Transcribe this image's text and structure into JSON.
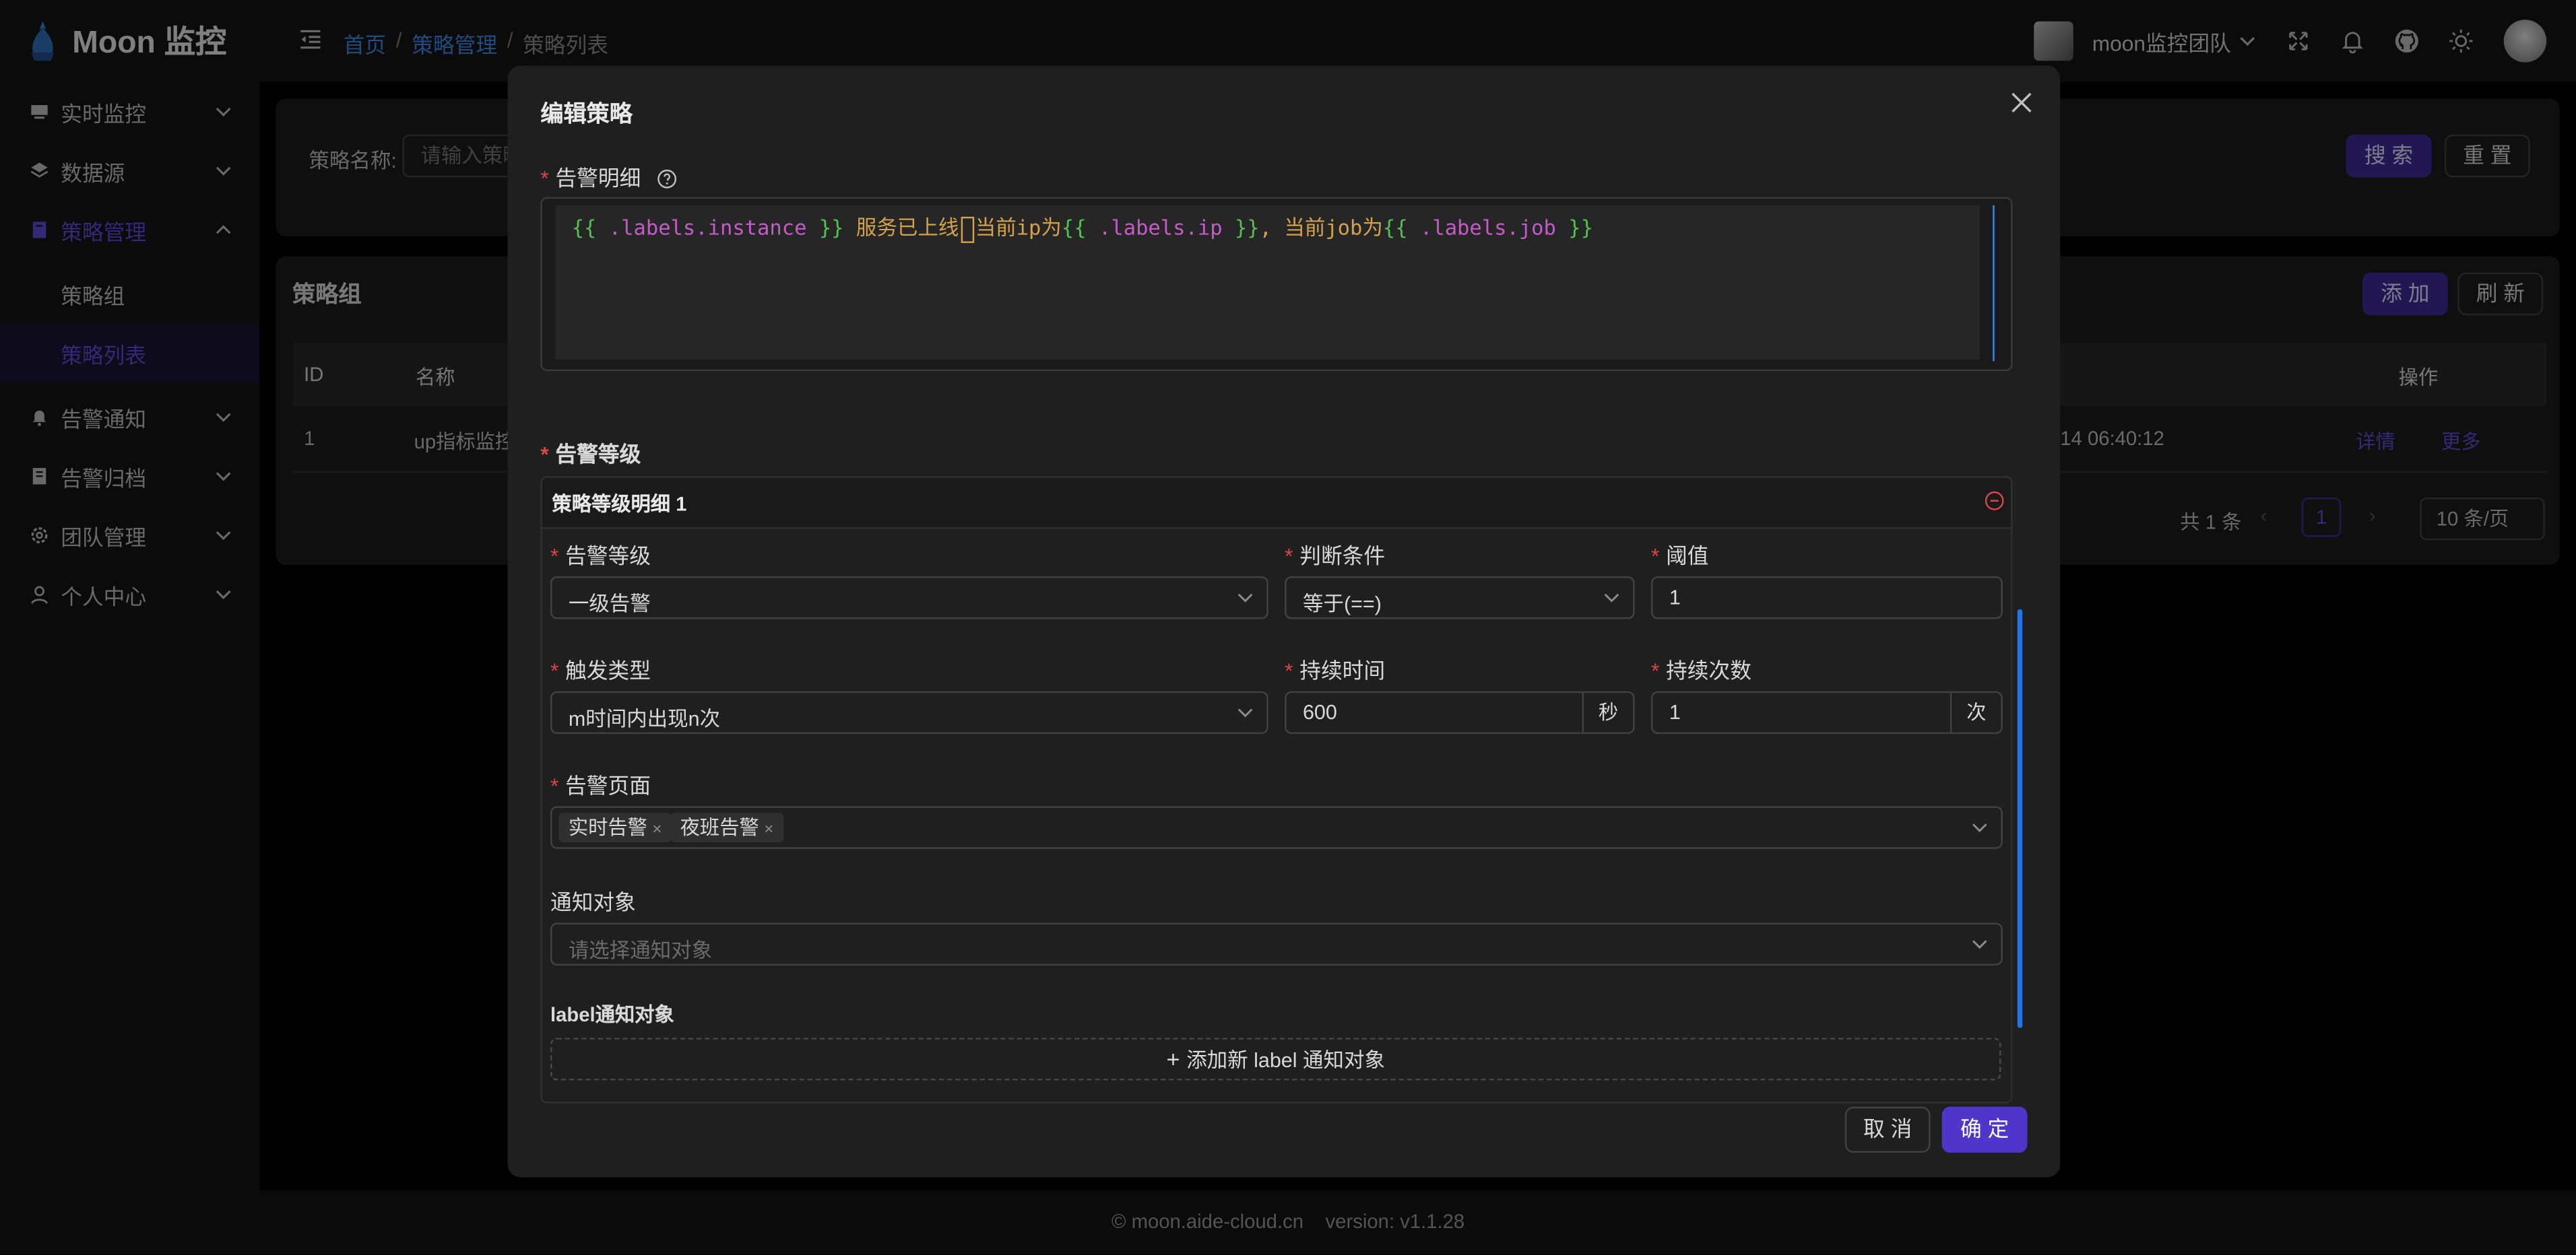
{
  "app": {
    "title": "Moon 监控"
  },
  "breadcrumb": [
    "首页",
    "策略管理",
    "策略列表"
  ],
  "header": {
    "team": "moon监控团队"
  },
  "sidebar": {
    "items": [
      {
        "label": "实时监控"
      },
      {
        "label": "数据源"
      },
      {
        "label": "策略管理"
      },
      {
        "label": "策略组"
      },
      {
        "label": "策略列表"
      },
      {
        "label": "告警通知"
      },
      {
        "label": "告警归档"
      },
      {
        "label": "团队管理"
      },
      {
        "label": "个人中心"
      }
    ]
  },
  "search": {
    "label": "策略名称:",
    "placeholder": "请输入策略",
    "search_btn": "搜 索",
    "reset_btn": "重 置"
  },
  "list": {
    "title": "策略组",
    "add_btn": "添 加",
    "refresh_btn": "刷 新",
    "columns": {
      "id": "ID",
      "name": "名称",
      "action": "操作"
    },
    "row": {
      "id": "1",
      "name": "up指标监控",
      "time": "14 06:40:12",
      "detail": "详情",
      "more": "更多"
    },
    "pagination": {
      "total": "共 1 条",
      "page": "1",
      "size": "10 条/页"
    }
  },
  "modal": {
    "title": "编辑策略",
    "detail_label": "告警明细",
    "code": {
      "p1": "{{",
      "p2": " .labels.instance ",
      "p3": "}}",
      "p4": " 服务已上线",
      "p5": "当前ip为",
      "p6": "{{",
      "p7": " .labels.ip ",
      "p8": "}}",
      "p9": ", 当前job为",
      "p10": "{{",
      "p11": " .labels.job ",
      "p12": "}}"
    },
    "level_section_label": "告警等级",
    "level_card": {
      "title": "策略等级明细 1",
      "level_label": "告警等级",
      "level_value": "一级告警",
      "cond_label": "判断条件",
      "cond_value": "等于(==)",
      "threshold_label": "阈值",
      "threshold_value": "1",
      "trigger_label": "触发类型",
      "trigger_value": "m时间内出现n次",
      "duration_label": "持续时间",
      "duration_value": "600",
      "duration_unit": "秒",
      "count_label": "持续次数",
      "count_value": "1",
      "count_unit": "次",
      "page_label": "告警页面",
      "page_tags": [
        "实时告警",
        "夜班告警"
      ],
      "notify_label": "通知对象",
      "notify_placeholder": "请选择通知对象",
      "label_notify_title": "label通知对象",
      "add_label_btn": "添加新 label 通知对象"
    },
    "cancel_btn": "取 消",
    "ok_btn": "确 定"
  },
  "footer": {
    "domain": "moon.aide-cloud.cn",
    "version": "version: v1.1.28"
  }
}
